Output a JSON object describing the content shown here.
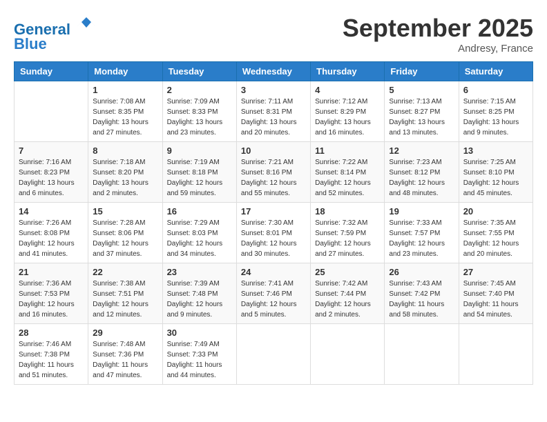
{
  "header": {
    "logo_line1": "General",
    "logo_line2": "Blue",
    "month_title": "September 2025",
    "location": "Andresy, France"
  },
  "weekdays": [
    "Sunday",
    "Monday",
    "Tuesday",
    "Wednesday",
    "Thursday",
    "Friday",
    "Saturday"
  ],
  "weeks": [
    [
      {
        "day": "",
        "info": ""
      },
      {
        "day": "1",
        "info": "Sunrise: 7:08 AM\nSunset: 8:35 PM\nDaylight: 13 hours\nand 27 minutes."
      },
      {
        "day": "2",
        "info": "Sunrise: 7:09 AM\nSunset: 8:33 PM\nDaylight: 13 hours\nand 23 minutes."
      },
      {
        "day": "3",
        "info": "Sunrise: 7:11 AM\nSunset: 8:31 PM\nDaylight: 13 hours\nand 20 minutes."
      },
      {
        "day": "4",
        "info": "Sunrise: 7:12 AM\nSunset: 8:29 PM\nDaylight: 13 hours\nand 16 minutes."
      },
      {
        "day": "5",
        "info": "Sunrise: 7:13 AM\nSunset: 8:27 PM\nDaylight: 13 hours\nand 13 minutes."
      },
      {
        "day": "6",
        "info": "Sunrise: 7:15 AM\nSunset: 8:25 PM\nDaylight: 13 hours\nand 9 minutes."
      }
    ],
    [
      {
        "day": "7",
        "info": "Sunrise: 7:16 AM\nSunset: 8:23 PM\nDaylight: 13 hours\nand 6 minutes."
      },
      {
        "day": "8",
        "info": "Sunrise: 7:18 AM\nSunset: 8:20 PM\nDaylight: 13 hours\nand 2 minutes."
      },
      {
        "day": "9",
        "info": "Sunrise: 7:19 AM\nSunset: 8:18 PM\nDaylight: 12 hours\nand 59 minutes."
      },
      {
        "day": "10",
        "info": "Sunrise: 7:21 AM\nSunset: 8:16 PM\nDaylight: 12 hours\nand 55 minutes."
      },
      {
        "day": "11",
        "info": "Sunrise: 7:22 AM\nSunset: 8:14 PM\nDaylight: 12 hours\nand 52 minutes."
      },
      {
        "day": "12",
        "info": "Sunrise: 7:23 AM\nSunset: 8:12 PM\nDaylight: 12 hours\nand 48 minutes."
      },
      {
        "day": "13",
        "info": "Sunrise: 7:25 AM\nSunset: 8:10 PM\nDaylight: 12 hours\nand 45 minutes."
      }
    ],
    [
      {
        "day": "14",
        "info": "Sunrise: 7:26 AM\nSunset: 8:08 PM\nDaylight: 12 hours\nand 41 minutes."
      },
      {
        "day": "15",
        "info": "Sunrise: 7:28 AM\nSunset: 8:06 PM\nDaylight: 12 hours\nand 37 minutes."
      },
      {
        "day": "16",
        "info": "Sunrise: 7:29 AM\nSunset: 8:03 PM\nDaylight: 12 hours\nand 34 minutes."
      },
      {
        "day": "17",
        "info": "Sunrise: 7:30 AM\nSunset: 8:01 PM\nDaylight: 12 hours\nand 30 minutes."
      },
      {
        "day": "18",
        "info": "Sunrise: 7:32 AM\nSunset: 7:59 PM\nDaylight: 12 hours\nand 27 minutes."
      },
      {
        "day": "19",
        "info": "Sunrise: 7:33 AM\nSunset: 7:57 PM\nDaylight: 12 hours\nand 23 minutes."
      },
      {
        "day": "20",
        "info": "Sunrise: 7:35 AM\nSunset: 7:55 PM\nDaylight: 12 hours\nand 20 minutes."
      }
    ],
    [
      {
        "day": "21",
        "info": "Sunrise: 7:36 AM\nSunset: 7:53 PM\nDaylight: 12 hours\nand 16 minutes."
      },
      {
        "day": "22",
        "info": "Sunrise: 7:38 AM\nSunset: 7:51 PM\nDaylight: 12 hours\nand 12 minutes."
      },
      {
        "day": "23",
        "info": "Sunrise: 7:39 AM\nSunset: 7:48 PM\nDaylight: 12 hours\nand 9 minutes."
      },
      {
        "day": "24",
        "info": "Sunrise: 7:41 AM\nSunset: 7:46 PM\nDaylight: 12 hours\nand 5 minutes."
      },
      {
        "day": "25",
        "info": "Sunrise: 7:42 AM\nSunset: 7:44 PM\nDaylight: 12 hours\nand 2 minutes."
      },
      {
        "day": "26",
        "info": "Sunrise: 7:43 AM\nSunset: 7:42 PM\nDaylight: 11 hours\nand 58 minutes."
      },
      {
        "day": "27",
        "info": "Sunrise: 7:45 AM\nSunset: 7:40 PM\nDaylight: 11 hours\nand 54 minutes."
      }
    ],
    [
      {
        "day": "28",
        "info": "Sunrise: 7:46 AM\nSunset: 7:38 PM\nDaylight: 11 hours\nand 51 minutes."
      },
      {
        "day": "29",
        "info": "Sunrise: 7:48 AM\nSunset: 7:36 PM\nDaylight: 11 hours\nand 47 minutes."
      },
      {
        "day": "30",
        "info": "Sunrise: 7:49 AM\nSunset: 7:33 PM\nDaylight: 11 hours\nand 44 minutes."
      },
      {
        "day": "",
        "info": ""
      },
      {
        "day": "",
        "info": ""
      },
      {
        "day": "",
        "info": ""
      },
      {
        "day": "",
        "info": ""
      }
    ]
  ]
}
